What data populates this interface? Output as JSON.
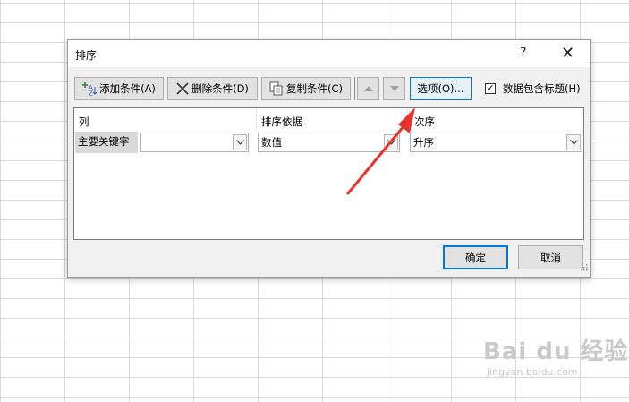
{
  "dialog": {
    "title": "排序",
    "help": "?",
    "close": "✕"
  },
  "toolbar": {
    "add_label": "添加条件(A)",
    "delete_label": "删除条件(D)",
    "copy_label": "复制条件(C)",
    "options_label": "选项(O)...",
    "has_headers_label": "数据包含标题(H)",
    "has_headers_checked": true
  },
  "grid": {
    "headers": {
      "column": "列",
      "sort_on": "排序依据",
      "order": "次序"
    },
    "rows": [
      {
        "label": "主要关键字",
        "column_value": "",
        "sort_on_value": "数值",
        "order_value": "升序"
      }
    ]
  },
  "footer": {
    "ok_label": "确定",
    "cancel_label": "取消"
  },
  "watermark": {
    "main": "Bai du 经验",
    "sub": "jingyan.baidu.com"
  },
  "colors": {
    "accent": "#0078d7",
    "arrow": "#e8322d"
  },
  "icons": [
    "add-condition-icon",
    "delete-condition-icon",
    "copy-condition-icon",
    "move-up-icon",
    "move-down-icon",
    "dropdown-arrow-icon",
    "checkbox-check-icon",
    "resize-grip-icon"
  ]
}
